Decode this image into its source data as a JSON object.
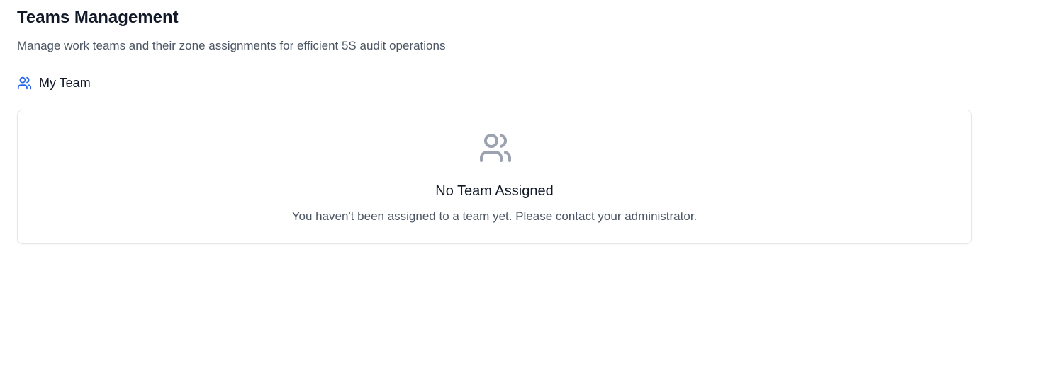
{
  "header": {
    "title": "Teams Management",
    "subtitle": "Manage work teams and their zone assignments for efficient 5S audit operations"
  },
  "section": {
    "title": "My Team",
    "icon": "users-icon",
    "icon_color": "#2563eb"
  },
  "empty_state": {
    "icon": "users-icon",
    "icon_color": "#9ca3af",
    "title": "No Team Assigned",
    "message": "You haven't been assigned to a team yet. Please contact your administrator."
  }
}
